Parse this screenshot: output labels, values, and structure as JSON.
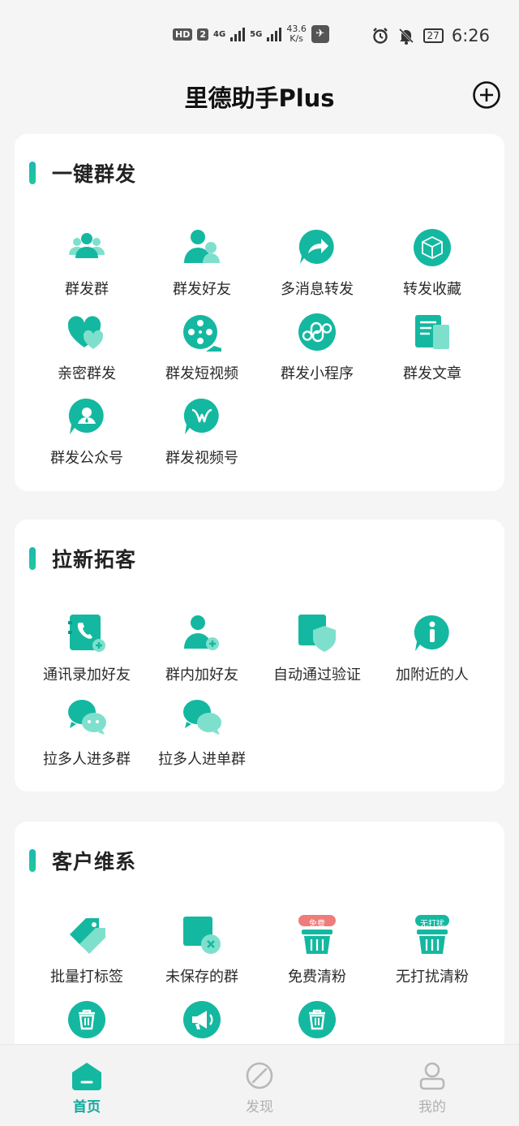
{
  "status_bar": {
    "hd": "HD",
    "sim": "2",
    "net1": "4G",
    "net2": "5G",
    "speed_value": "43.6",
    "speed_unit": "K/s",
    "battery": "27",
    "time": "6:26"
  },
  "header": {
    "title": "里德助手Plus"
  },
  "colors": {
    "accent": "#14b8a0",
    "accent_light": "#7ee0cc",
    "bg": "#f5f5f5"
  },
  "sections": [
    {
      "title": "一键群发",
      "items": [
        {
          "label": "群发群",
          "icon": "group-icon"
        },
        {
          "label": "群发好友",
          "icon": "friends-icon"
        },
        {
          "label": "多消息转发",
          "icon": "forward-icon"
        },
        {
          "label": "转发收藏",
          "icon": "cube-icon"
        },
        {
          "label": "亲密群发",
          "icon": "hearts-icon"
        },
        {
          "label": "群发短视频",
          "icon": "film-reel-icon"
        },
        {
          "label": "群发小程序",
          "icon": "mini-program-icon"
        },
        {
          "label": "群发文章",
          "icon": "article-icon"
        },
        {
          "label": "群发公众号",
          "icon": "official-account-icon"
        },
        {
          "label": "群发视频号",
          "icon": "channels-icon"
        }
      ]
    },
    {
      "title": "拉新拓客",
      "items": [
        {
          "label": "通讯录加好友",
          "icon": "contacts-add-icon"
        },
        {
          "label": "群内加好友",
          "icon": "person-add-icon"
        },
        {
          "label": "自动通过验证",
          "icon": "shield-icon"
        },
        {
          "label": "加附近的人",
          "icon": "info-bubble-icon"
        },
        {
          "label": "拉多人进多群",
          "icon": "chat-bubbles-icon"
        },
        {
          "label": "拉多人进单群",
          "icon": "chat-bubble-icon"
        }
      ]
    },
    {
      "title": "客户维系",
      "items": [
        {
          "label": "批量打标签",
          "icon": "tag-icon"
        },
        {
          "label": "未保存的群",
          "icon": "unsaved-group-icon"
        },
        {
          "label": "免费清粉",
          "icon": "basket-icon",
          "badge": "免费"
        },
        {
          "label": "无打扰清粉",
          "icon": "basket-icon",
          "badge": "无打扰"
        },
        {
          "label": "",
          "icon": "trash-icon"
        },
        {
          "label": "",
          "icon": "megaphone-icon"
        },
        {
          "label": "",
          "icon": "trash-icon"
        }
      ]
    }
  ],
  "tabs": [
    {
      "label": "首页",
      "icon": "home-icon",
      "active": true
    },
    {
      "label": "发现",
      "icon": "compass-icon",
      "active": false
    },
    {
      "label": "我的",
      "icon": "profile-icon",
      "active": false
    }
  ]
}
